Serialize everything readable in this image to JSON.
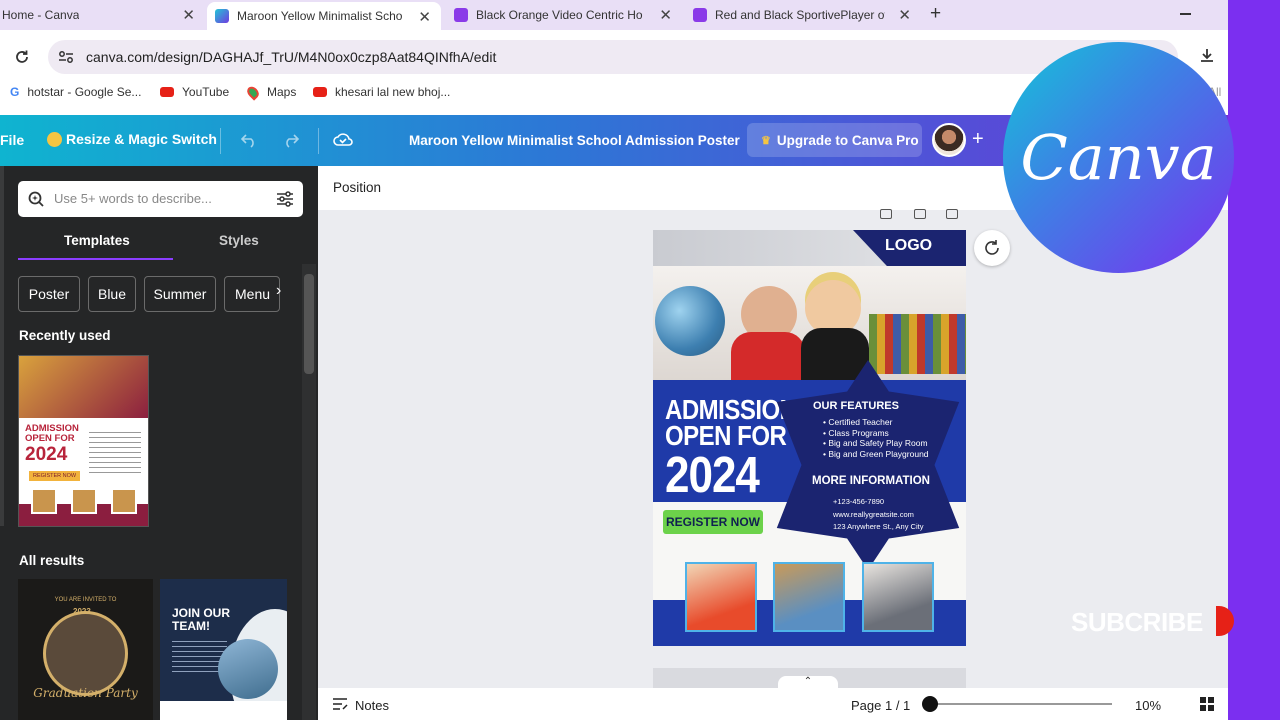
{
  "browser": {
    "tabs": [
      {
        "title": "Home - Canva",
        "close": "✕"
      },
      {
        "title": "Maroon Yellow Minimalist Scho",
        "close": "✕"
      },
      {
        "title": "Black Orange Video Centric Ho",
        "close": "✕"
      },
      {
        "title": "Red and Black SportivePlayer of",
        "close": "✕"
      }
    ],
    "new_tab": "+",
    "url": "canva.com/design/DAGHAJf_TrU/M4N0ox0czp8Aat84QINfhA/edit",
    "bookmarks": [
      "hotstar - Google Se...",
      "YouTube",
      "Maps",
      "khesari lal new bhoj..."
    ],
    "bookmarks_right": "All"
  },
  "toolbar": {
    "file": "File",
    "resize": "Resize & Magic Switch",
    "doc_title": "Maroon Yellow Minimalist School Admission Poster",
    "upgrade": "Upgrade to Canva Pro",
    "plus": "+"
  },
  "panel": {
    "search_placeholder": "Use 5+ words to describe...",
    "tabs": [
      "Templates",
      "Styles"
    ],
    "chips": [
      "Poster",
      "Blue",
      "Summer",
      "Menu"
    ],
    "recently_used": "Recently used",
    "all_results": "All results",
    "thumb1": {
      "headline": "ADMISSION OPEN FOR",
      "year": "2024",
      "cta": "REGISTER NOW"
    },
    "thumb2": {
      "top": "YOU ARE INVITED TO",
      "year": "2023",
      "script": "Graduation Party"
    },
    "thumb3": {
      "headline": "JOIN OUR TEAM!"
    }
  },
  "editor": {
    "position": "Position",
    "notes": "Notes",
    "page": "Page 1 / 1",
    "zoom": "10%",
    "zoom_level": 0.0
  },
  "poster": {
    "logo": "LOGO",
    "headline1": "ADMISSION",
    "headline2": "OPEN FOR",
    "year": "2024",
    "features_title": "OUR FEATURES",
    "features": [
      "Certified Teacher",
      "Class Programs",
      "Big and Safety Play Room",
      "Big and Green Playground"
    ],
    "info_title": "MORE INFORMATION",
    "info": [
      "+123-456-7890",
      "www.reallygreatsite.com",
      "123 Anywhere St., Any City"
    ],
    "cta": "REGISTER NOW"
  },
  "overlay": {
    "canva_logo": "Canva",
    "subscribe": "SUBCRIBE"
  },
  "colors": {
    "poster_blue": "#1f3aa8",
    "poster_navy": "#1b2470",
    "cta_green": "#6cd24a",
    "accent_purple": "#7b2ff0"
  }
}
